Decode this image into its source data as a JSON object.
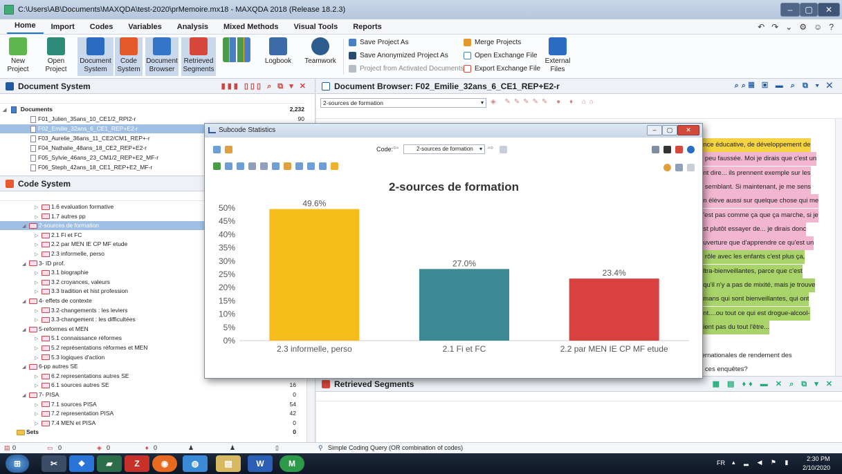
{
  "window": {
    "title": "C:\\Users\\AB\\Documents\\MAXQDA\\test-2020\\prMemoire.mx18 - MAXQDA 2018 (Release 18.2.3)"
  },
  "menu": [
    "Home",
    "Import",
    "Codes",
    "Variables",
    "Analysis",
    "Mixed Methods",
    "Visual Tools",
    "Reports"
  ],
  "ribbon": {
    "new_project": "New Project",
    "open_project": "Open Project",
    "document_system": "Document System",
    "code_system": "Code System",
    "document_browser": "Document Browser",
    "retrieved_segments": "Retrieved Segments",
    "logbook": "Logbook",
    "teamwork": "Teamwork",
    "save_project_as": "Save Project As",
    "save_anonymized": "Save Anonymized Project As",
    "project_from_activated": "Project from Activated Documents",
    "merge_projects": "Merge Projects",
    "open_exchange": "Open Exchange File",
    "export_exchange": "Export Exchange File",
    "external_files": "External Files"
  },
  "document_system": {
    "title": "Document System",
    "root_label": "Documents",
    "root_count": "2,232",
    "docs": [
      {
        "label": "F01_Julien_35ans_10_CE1/2_RPI2-r",
        "count": "90"
      },
      {
        "label": "F02_Emilie_32ans_6_CE1_REP+E2-r",
        "count": ""
      },
      {
        "label": "F03_Aurelie_36ans_11_CE2/CM1_REP+-r",
        "count": ""
      },
      {
        "label": "F04_Nathalie_48ans_18_CE2_REP+E2-r",
        "count": ""
      },
      {
        "label": "F05_Sylvie_46ans_23_CM1/2_REP+E2_MF-r",
        "count": ""
      },
      {
        "label": "F06_Steph_42ans_18_CE1_REP+E2_MF-r",
        "count": ""
      }
    ]
  },
  "code_system": {
    "title": "Code System",
    "rows": [
      {
        "label": "1.6 evaluation formative",
        "count": "",
        "indent": 2,
        "sel": false
      },
      {
        "label": "1.7 autres pp",
        "count": "",
        "indent": 2,
        "sel": false
      },
      {
        "label": "2-sources de formation",
        "count": "",
        "indent": 1,
        "sel": true
      },
      {
        "label": "2.1 Fi et FC",
        "count": "",
        "indent": 2,
        "sel": false
      },
      {
        "label": "2.2 par MEN IE CP MF etude",
        "count": "",
        "indent": 2,
        "sel": false
      },
      {
        "label": "2.3 informelle, perso",
        "count": "",
        "indent": 2,
        "sel": false
      },
      {
        "label": "3- ID prof.",
        "count": "",
        "indent": 1,
        "sel": false
      },
      {
        "label": "3.1 biographie",
        "count": "",
        "indent": 2,
        "sel": false
      },
      {
        "label": "3.2 croyances, valeurs",
        "count": "",
        "indent": 2,
        "sel": false
      },
      {
        "label": "3.3 tradition et hist profession",
        "count": "",
        "indent": 2,
        "sel": false
      },
      {
        "label": "4- effets de contexte",
        "count": "",
        "indent": 1,
        "sel": false
      },
      {
        "label": "3.2-changements : les leviers",
        "count": "",
        "indent": 2,
        "sel": false
      },
      {
        "label": "3.3-changement : les difficultées",
        "count": "",
        "indent": 2,
        "sel": false
      },
      {
        "label": "5-reformes et MEN",
        "count": "",
        "indent": 1,
        "sel": false
      },
      {
        "label": "5.1 connaissance réformes",
        "count": "",
        "indent": 2,
        "sel": false
      },
      {
        "label": "5.2 représentations réformes et MEN",
        "count": "",
        "indent": 2,
        "sel": false
      },
      {
        "label": "5.3 logiques d'action",
        "count": "",
        "indent": 2,
        "sel": false
      },
      {
        "label": "6-pp autres SE",
        "count": "",
        "indent": 1,
        "sel": false
      },
      {
        "label": "6.2 representations autres SE",
        "count": "",
        "indent": 2,
        "sel": false
      },
      {
        "label": "6.1 sources autres SE",
        "count": "16",
        "indent": 2,
        "sel": false
      },
      {
        "label": "7- PISA",
        "count": "0",
        "indent": 1,
        "sel": false
      },
      {
        "label": "7.1 sources PISA",
        "count": "54",
        "indent": 2,
        "sel": false
      },
      {
        "label": "7.2 representation PISA",
        "count": "42",
        "indent": 2,
        "sel": false
      },
      {
        "label": "7.4 MEN et PISA",
        "count": "0",
        "indent": 2,
        "sel": false
      },
      {
        "label": "Sets",
        "count": "0",
        "indent": 0,
        "sel": false
      }
    ]
  },
  "document_browser": {
    "title": "Document Browser: F02_Emilie_32ans_6_CE1_REP+E2-r",
    "code_select": "2-sources de formation",
    "lines": [
      {
        "text": "ance éducative, de développement de",
        "color": "#f5d342"
      },
      {
        "text": "n peu faussée. Moi je dirais que c'est un",
        "color": "#f2b6d0"
      },
      {
        "text": "ent dire... ils prennent exemple sur les",
        "color": "#f2b6d0"
      },
      {
        "text": "e semblant. Si maintenant, je me sens",
        "color": "#f2b6d0"
      },
      {
        "text": "un élève aussi sur quelque chose qui me",
        "color": "#f2b6d0"
      },
      {
        "text": "n'est pas comme ça que ça marche, si je",
        "color": "#f2b6d0"
      },
      {
        "text": "est plutôt essayer de... je dirais donc",
        "color": "#f2b6d0"
      },
      {
        "text": "ouverture que d'apprendre ce qu'est un",
        "color": "#f2b6d0"
      },
      {
        "text": "e rôle avec les enfants c'est plus ça,",
        "color": "#a9d46a"
      },
      {
        "text": "ultra-bienveillantes, parce que c'est",
        "color": "#a9d46a"
      },
      {
        "text": "t qu'il n'y a pas de mixité, mais je trouve",
        "color": "#a9d46a"
      },
      {
        "text": "amans qui sont bienveillantes, qui ont",
        "color": "#a9d46a"
      },
      {
        "text": "ont....ou tout ce qui est drogue-alcool-",
        "color": "#a9d46a"
      },
      {
        "text": "aient pas du tout l'être...",
        "color": "#a9d46a"
      },
      {
        "text": "",
        "color": ""
      },
      {
        "text": "ternationales de rendement des",
        "color": ""
      },
      {
        "text": "e ces enquêtes?",
        "color": ""
      }
    ]
  },
  "retrieved_segments": {
    "title": "Retrieved Segments"
  },
  "status_bar": {
    "counts": [
      "0",
      "0",
      "0",
      "0"
    ],
    "query": "Simple Coding Query (OR combination of codes)"
  },
  "dialog": {
    "title": "Subcode Statistics",
    "code_label": "Code:",
    "code_value": "2-sources de formation"
  },
  "chart_data": {
    "type": "bar",
    "title": "2-sources de formation",
    "categories": [
      "2.3 informelle, perso",
      "2.1 Fi et FC",
      "2.2 par MEN IE CP MF etude"
    ],
    "values": [
      49.6,
      27.0,
      23.4
    ],
    "value_labels": [
      "49.6%",
      "27.0%",
      "23.4%"
    ],
    "colors": [
      "#f6bd1a",
      "#3b8a94",
      "#d94141"
    ],
    "ylim": [
      0,
      50
    ],
    "yticks": [
      "0%",
      "5%",
      "10%",
      "15%",
      "20%",
      "25%",
      "30%",
      "35%",
      "40%",
      "45%",
      "50%"
    ],
    "xlabel": "",
    "ylabel": "",
    "grid": false,
    "legend": "none"
  },
  "taskbar": {
    "lang": "FR",
    "time": "2:30 PM",
    "date": "2/10/2020"
  }
}
